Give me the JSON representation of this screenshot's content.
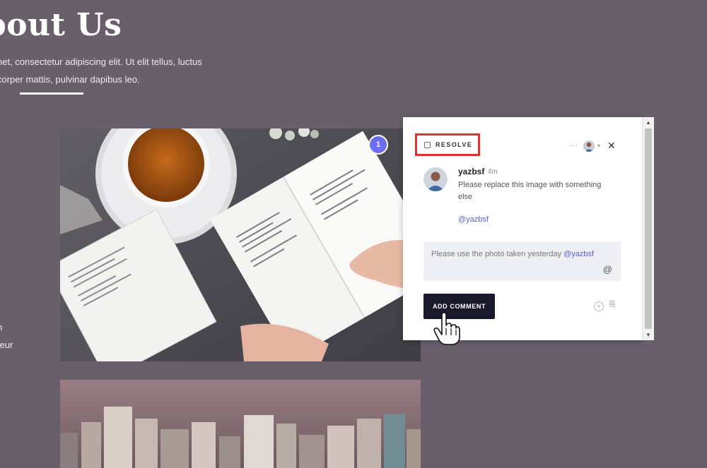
{
  "hero": {
    "title": "bout Us",
    "line1": "net, consectetur adipiscing elit. Ut elit tellus, luctus",
    "line2": "corper mattis, pulvinar dapibus leo."
  },
  "side": {
    "text1": "n",
    "text2": "teur"
  },
  "marker": {
    "number": "1",
    "color": "#6e6cf0"
  },
  "panel": {
    "resolve_label": "RESOLVE",
    "more_label": "···",
    "close_label": "✕",
    "comment": {
      "username": "yazbsf",
      "time": "4m",
      "text": "Please replace this image with something else",
      "mention": "@yazbsf"
    },
    "reply": {
      "text": "Please use the photo taken yesterday",
      "mention": "@yazbsf",
      "at_symbol": "@"
    },
    "add_comment_label": "ADD COMMENT",
    "highlight_color": "#e0322b"
  },
  "icons": [
    "dots-icon",
    "close-icon",
    "at-icon",
    "emoji-icon",
    "attach-icon",
    "hand-cursor-icon"
  ]
}
